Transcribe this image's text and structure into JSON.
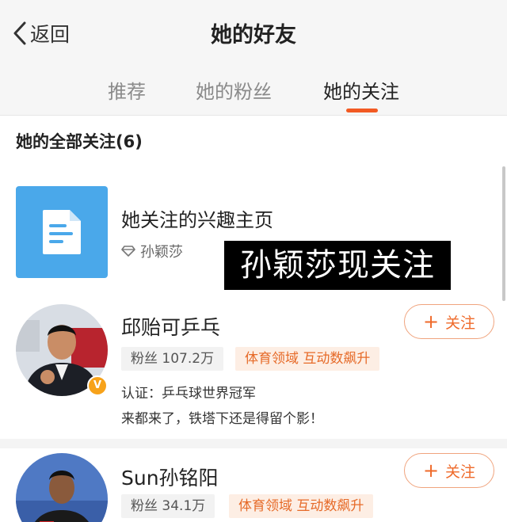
{
  "header": {
    "back_label": "返回",
    "title": "她的好友"
  },
  "tabs": [
    {
      "label": "推荐",
      "active": false
    },
    {
      "label": "她的粉丝",
      "active": false
    },
    {
      "label": "她的关注",
      "active": true
    }
  ],
  "section_title": "她的全部关注(6)",
  "interest": {
    "title": "她关注的兴趣主页",
    "owner": "孙颖莎"
  },
  "overlay_caption": "孙颖莎现关注",
  "users": [
    {
      "name": "邱贻可乒乓",
      "fans": "粉丝 107.2万",
      "domain_tag": "体育领域 互动数飙升",
      "verification": "认证：乒乓球世界冠军",
      "bio": "来都来了，铁塔下还是得留个影！",
      "follow_label": "关注",
      "badge": "V"
    },
    {
      "name": "Sun孙铭阳",
      "fans": "粉丝 34.1万",
      "domain_tag": "体育领域 互动数飙升",
      "follow_label": "关注"
    }
  ],
  "colors": {
    "accent": "#f25a23",
    "follow_text": "#ef6a2a",
    "interest_icon_bg": "#4aa8ea"
  }
}
